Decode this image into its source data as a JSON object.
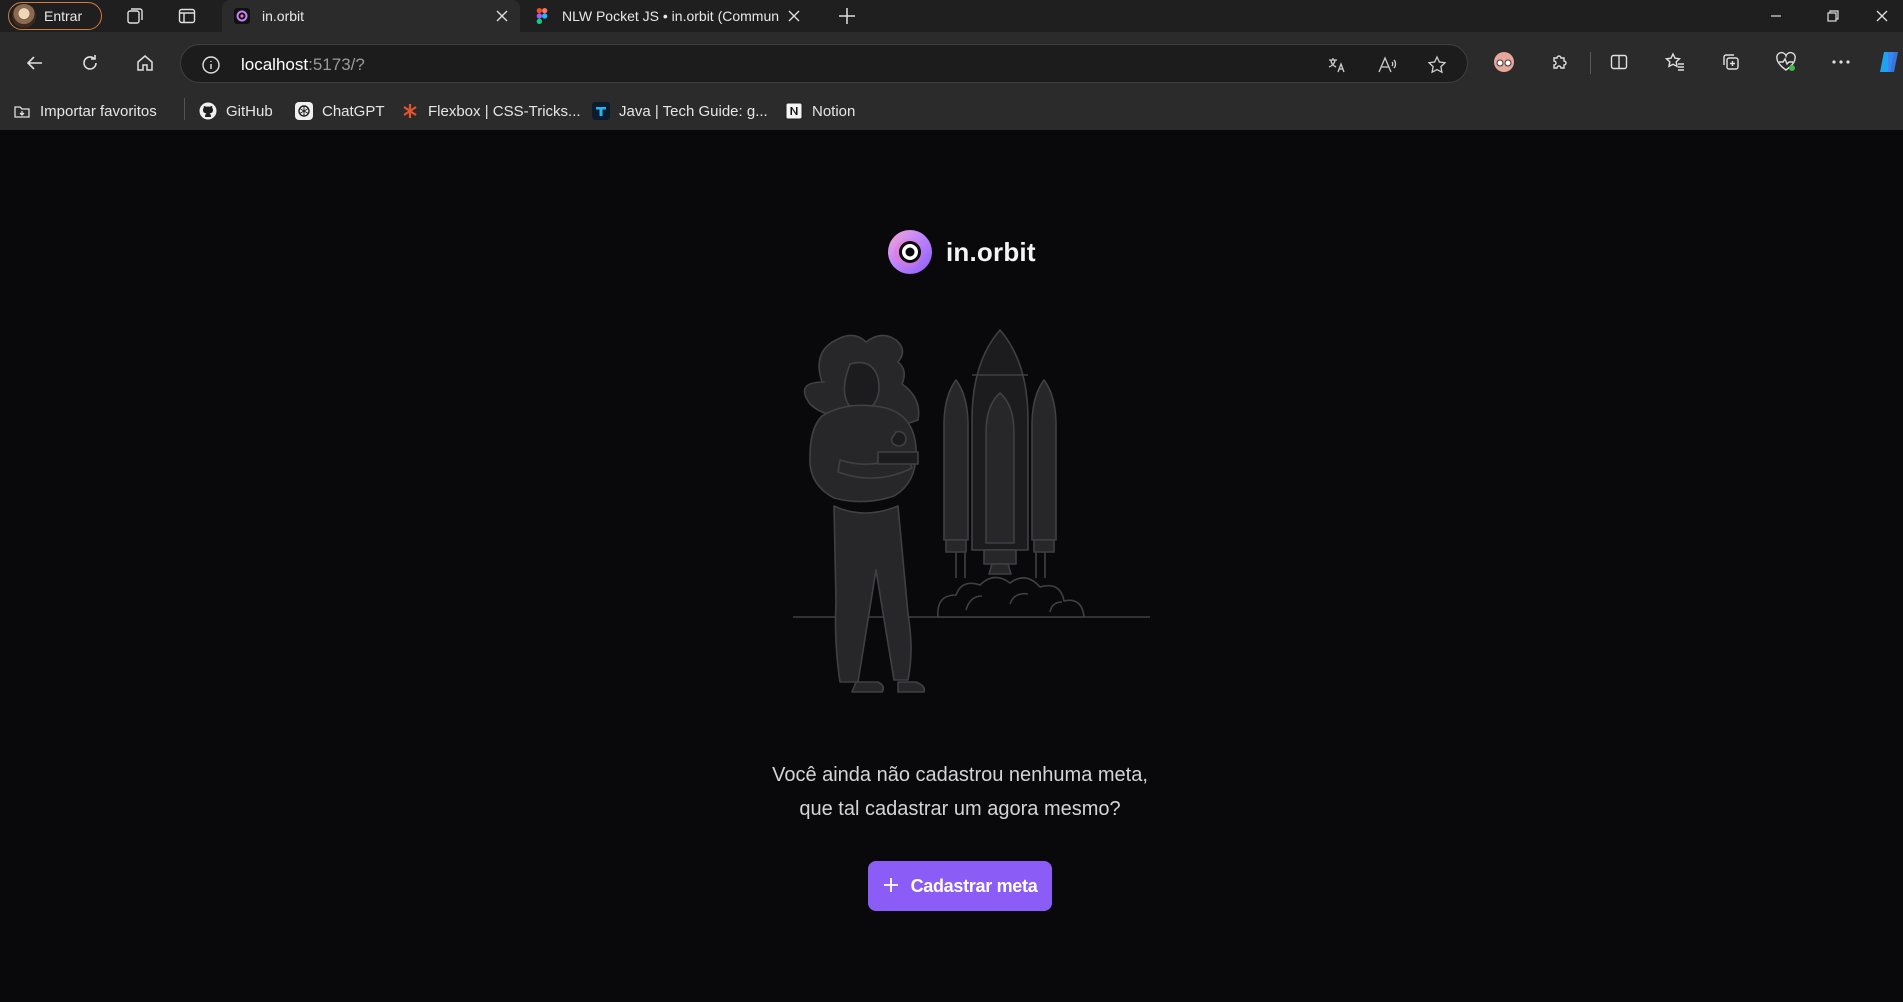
{
  "browser": {
    "profile_label": "Entrar",
    "tabs": [
      {
        "title": "in.orbit",
        "active": true
      },
      {
        "title": "NLW Pocket JS • in.orbit (Commun",
        "active": false
      }
    ],
    "address": {
      "host": "localhost",
      "rest": ":5173/?"
    },
    "bookmarks": [
      {
        "label": "Importar favoritos",
        "icon": "import-icon"
      },
      {
        "label": "GitHub",
        "icon": "github-icon"
      },
      {
        "label": "ChatGPT",
        "icon": "chatgpt-icon"
      },
      {
        "label": "Flexbox | CSS-Tricks...",
        "icon": "csstricks-icon"
      },
      {
        "label": "Java | Tech Guide: g...",
        "icon": "techguide-icon"
      },
      {
        "label": "Notion",
        "icon": "notion-icon"
      }
    ]
  },
  "page": {
    "logo_text": "in.orbit",
    "empty_line1": "Você ainda não cadastrou nenhuma meta,",
    "empty_line2": "que tal cadastrar um agora mesmo?",
    "cta_label": "Cadastrar meta",
    "accent_color": "#8b5cf6"
  }
}
